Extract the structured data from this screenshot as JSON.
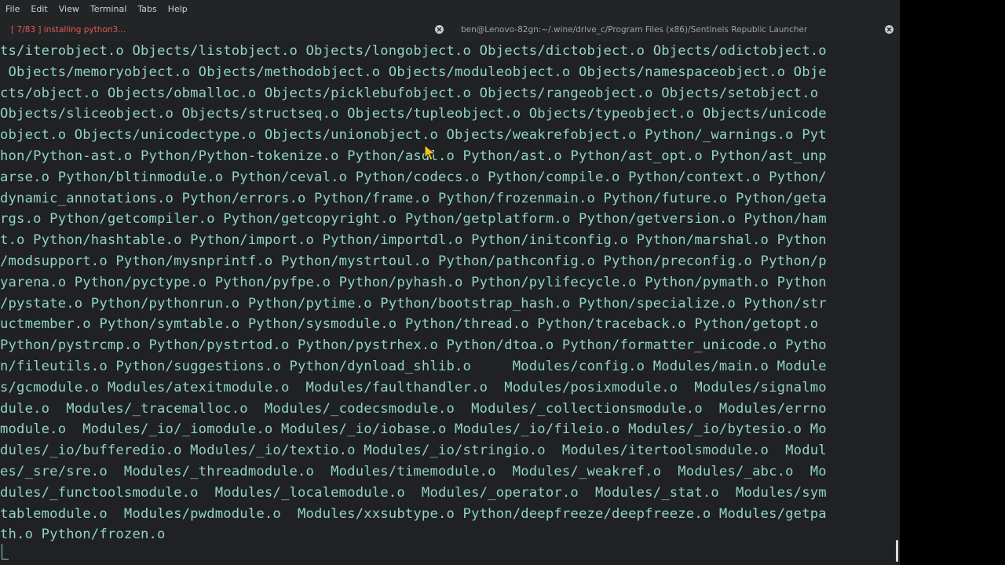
{
  "menu": [
    "File",
    "Edit",
    "View",
    "Terminal",
    "Tabs",
    "Help"
  ],
  "tabs": [
    {
      "label": "[ 7/83 ] installing python3..."
    },
    {
      "label": "ben@Lenovo-82gn:~/.wine/drive_c/Program Files (x86)/Sentinels Republic Launcher"
    }
  ],
  "terminal": {
    "lines": [
      "ts/iterobject.o Objects/listobject.o Objects/longobject.o Objects/dictobject.o Objects/odictobject.o",
      " Objects/memoryobject.o Objects/methodobject.o Objects/moduleobject.o Objects/namespaceobject.o Obje",
      "cts/object.o Objects/obmalloc.o Objects/picklebufobject.o Objects/rangeobject.o Objects/setobject.o",
      "Objects/sliceobject.o Objects/structseq.o Objects/tupleobject.o Objects/typeobject.o Objects/unicode",
      "object.o Objects/unicodectype.o Objects/unionobject.o Objects/weakrefobject.o Python/_warnings.o Pyt",
      "hon/Python-ast.o Python/Python-tokenize.o Python/asdl.o Python/ast.o Python/ast_opt.o Python/ast_unp",
      "arse.o Python/bltinmodule.o Python/ceval.o Python/codecs.o Python/compile.o Python/context.o Python/",
      "dynamic_annotations.o Python/errors.o Python/frame.o Python/frozenmain.o Python/future.o Python/geta",
      "rgs.o Python/getcompiler.o Python/getcopyright.o Python/getplatform.o Python/getversion.o Python/ham",
      "t.o Python/hashtable.o Python/import.o Python/importdl.o Python/initconfig.o Python/marshal.o Python",
      "/modsupport.o Python/mysnprintf.o Python/mystrtoul.o Python/pathconfig.o Python/preconfig.o Python/p",
      "yarena.o Python/pyctype.o Python/pyfpe.o Python/pyhash.o Python/pylifecycle.o Python/pymath.o Python",
      "/pystate.o Python/pythonrun.o Python/pytime.o Python/bootstrap_hash.o Python/specialize.o Python/str",
      "uctmember.o Python/symtable.o Python/sysmodule.o Python/thread.o Python/traceback.o Python/getopt.o",
      "Python/pystrcmp.o Python/pystrtod.o Python/pystrhex.o Python/dtoa.o Python/formatter_unicode.o Pytho",
      "n/fileutils.o Python/suggestions.o Python/dynload_shlib.o     Modules/config.o Modules/main.o Module",
      "s/gcmodule.o Modules/atexitmodule.o  Modules/faulthandler.o  Modules/posixmodule.o  Modules/signalmo",
      "dule.o  Modules/_tracemalloc.o  Modules/_codecsmodule.o  Modules/_collectionsmodule.o  Modules/errno",
      "module.o  Modules/_io/_iomodule.o Modules/_io/iobase.o Modules/_io/fileio.o Modules/_io/bytesio.o Mo",
      "dules/_io/bufferedio.o Modules/_io/textio.o Modules/_io/stringio.o  Modules/itertoolsmodule.o  Modul",
      "es/_sre/sre.o  Modules/_threadmodule.o  Modules/timemodule.o  Modules/_weakref.o  Modules/_abc.o  Mo",
      "dules/_functoolsmodule.o  Modules/_localemodule.o  Modules/_operator.o  Modules/_stat.o  Modules/sym",
      "tablemodule.o  Modules/pwdmodule.o  Modules/xxsubtype.o Python/deepfreeze/deepfreeze.o Modules/getpa",
      "th.o Python/frozen.o"
    ]
  },
  "colors": {
    "terminal_text": "#8fd3c8",
    "terminal_bg": "#202122",
    "active_tab_text": "#e05a5a",
    "inactive_tab_text": "#9ea2a6"
  },
  "icons": {
    "tab_close": "close-icon",
    "pointer": "mouse-pointer-icon"
  }
}
